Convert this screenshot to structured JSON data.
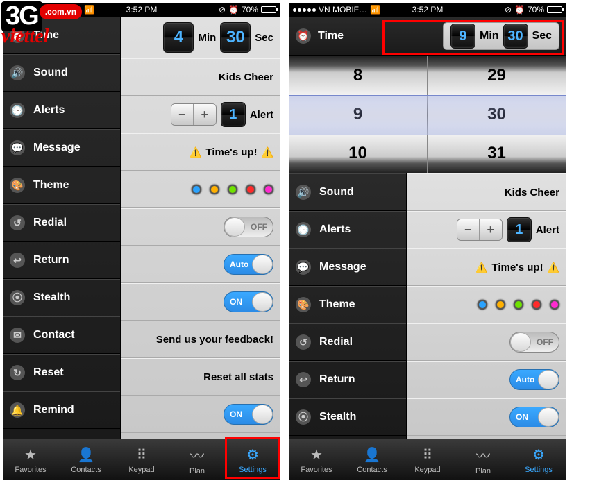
{
  "logo": {
    "big": "3G",
    "bubble": ".com.vn",
    "brand": "viettel"
  },
  "status": {
    "carrier": "VN MOBIF…",
    "time": "3:52 PM",
    "battery": "70%"
  },
  "sidebar": {
    "items": [
      {
        "icon": "⏰",
        "label": "Time"
      },
      {
        "icon": "🔊",
        "label": "Sound"
      },
      {
        "icon": "🕒",
        "label": "Alerts"
      },
      {
        "icon": "💬",
        "label": "Message"
      },
      {
        "icon": "🎨",
        "label": "Theme"
      },
      {
        "icon": "↺",
        "label": "Redial"
      },
      {
        "icon": "↩",
        "label": "Return"
      },
      {
        "icon": "⦿",
        "label": "Stealth"
      },
      {
        "icon": "✉",
        "label": "Contact"
      },
      {
        "icon": "↻",
        "label": "Reset"
      },
      {
        "icon": "🔔",
        "label": "Remind"
      }
    ]
  },
  "left": {
    "time_min": "4",
    "time_sec": "30",
    "min_label": "Min",
    "sec_label": "Sec",
    "sound_value": "Kids Cheer",
    "alert_minus": "−",
    "alert_plus": "+",
    "alert_count": "1",
    "alert_label": "Alert",
    "message": "Time's up!",
    "redial_off": "OFF",
    "return_auto": "Auto",
    "stealth_on": "ON",
    "contact_text": "Send us your feedback!",
    "reset_text": "Reset all stats",
    "remind_on": "ON"
  },
  "right": {
    "time_label": "Time",
    "time_min": "9",
    "time_sec": "30",
    "min_label": "Min",
    "sec_label": "Sec",
    "picker": {
      "min": [
        "8",
        "9",
        "10"
      ],
      "sec": [
        "29",
        "30",
        "31"
      ]
    },
    "sound_value": "Kids Cheer",
    "alert_minus": "−",
    "alert_plus": "+",
    "alert_count": "1",
    "alert_label": "Alert",
    "message": "Time's up!",
    "redial_off": "OFF",
    "return_auto": "Auto",
    "stealth_on": "ON"
  },
  "tabs": [
    {
      "icon": "★",
      "label": "Favorites"
    },
    {
      "icon": "👤",
      "label": "Contacts"
    },
    {
      "icon": "⠿",
      "label": "Keypad"
    },
    {
      "icon": "〰",
      "label": "Plan"
    },
    {
      "icon": "⚙",
      "label": "Settings"
    }
  ]
}
